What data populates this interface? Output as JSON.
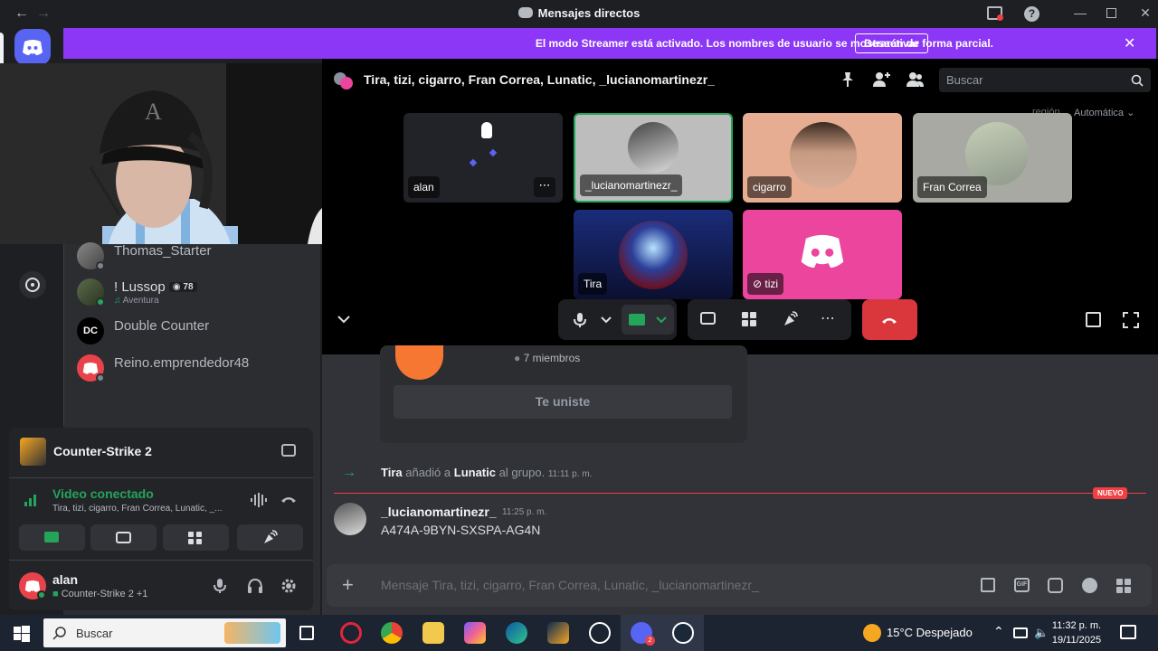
{
  "window": {
    "title": "Mensajes directos"
  },
  "banner": {
    "text": "El modo Streamer está activado. Los nombres de usuario se mostrarán de forma parcial.",
    "button": "Desactivar"
  },
  "dm_list": [
    {
      "name": "Thomas_Starter",
      "sub": ""
    },
    {
      "name": "! Lussop",
      "badge": "78",
      "sub": "Aventura"
    },
    {
      "name": "Double Counter",
      "sub": ""
    },
    {
      "name": "Reino.emprendedor48",
      "sub": ""
    }
  ],
  "voice_panel": {
    "game": "Counter-Strike 2",
    "connection_title": "Video conectado",
    "connection_sub": "Tira, tizi, cigarro, Fran Correa, Lunatic, _..."
  },
  "user": {
    "name": "alan",
    "status": "Counter-Strike 2 +1"
  },
  "call": {
    "title": "Tira, tizi, cigarro, Fran Correa, Lunatic, _lucianomartinezr_",
    "search_placeholder": "Buscar",
    "region_label": "región",
    "region_value": "Automática",
    "participants": [
      "alan",
      "_lucianomartinezr_",
      "cigarro",
      "Fran Correa",
      "Tira",
      "tizi"
    ]
  },
  "chat": {
    "group_members": "7 miembros",
    "joined_button": "Te uniste",
    "system_message": {
      "actor": "Tira",
      "verb": "añadió a",
      "target": "Lunatic",
      "suffix": "al grupo.",
      "time": "11:11 p. m."
    },
    "new_badge": "NUEVO",
    "message": {
      "author": "_lucianomartinezr_",
      "time": "11:25 p. m.",
      "text": "A474A-9BYN-SXSPA-AG4N"
    },
    "composer_placeholder": "Mensaje Tira, tizi, cigarro, Fran Correa, Lunatic, _lucianomartinezr_"
  },
  "taskbar": {
    "search": "Buscar",
    "weather": "15°C  Despejado",
    "time": "11:32 p. m.",
    "date": "19/11/2025"
  },
  "colors": {
    "accent": "#5865f2",
    "streamer_banner": "#8c37f5",
    "connected": "#23a55a",
    "danger": "#da373c",
    "mention_new": "#f23f43"
  }
}
